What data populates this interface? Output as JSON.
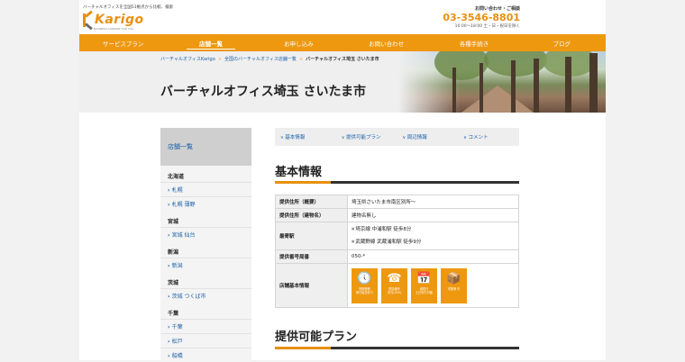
{
  "header": {
    "tagline": "バーチャルオフィスを全国51拠点から比較、検索",
    "logo_text": "Karigo",
    "logo_sub": "BUSINESS SUPPORT FOR YOU",
    "contact_label": "お問い合わせ・ご相談",
    "contact_phone": "03-3546-8801",
    "contact_hours": "10:00〜18:00 土・日・祝日を除く"
  },
  "nav": {
    "items": [
      "サービスプラン",
      "店舗一覧",
      "お申し込み",
      "お問い合わせ",
      "各種手続き",
      "ブログ"
    ]
  },
  "breadcrumb": {
    "items": [
      "バーチャルオフィスKarigo",
      "全国のバーチャルオフィス店舗一覧"
    ],
    "separator": "»",
    "current": "バーチャルオフィス埼玉 さいたま市"
  },
  "page_title": "バーチャルオフィス埼玉 さいたま市",
  "sidebar": {
    "heading": "店舗一覧",
    "groups": [
      {
        "region": "北海道",
        "items": [
          "札幌",
          "札幌 薄野"
        ]
      },
      {
        "region": "宮城",
        "items": [
          "宮城 仙台"
        ]
      },
      {
        "region": "新潟",
        "items": [
          "新潟"
        ]
      },
      {
        "region": "茨城",
        "items": [
          "茨城 つくば市"
        ]
      },
      {
        "region": "千葉",
        "items": [
          "千葉",
          "松戸",
          "船橋"
        ]
      }
    ]
  },
  "tabs": [
    "基本情報",
    "提供可能プラン",
    "周辺情報",
    "コメント"
  ],
  "basic": {
    "title": "基本情報",
    "rows": [
      {
        "label": "提供住所（概要）",
        "value": "埼玉県さいたま市南区別所〜"
      },
      {
        "label": "提供住所（建物名）",
        "value": "建物名無し"
      },
      {
        "label": "最寄駅",
        "values": [
          "埼京線 中浦和駅 徒歩8分",
          "武蔵野線 武蔵浦和駅 徒歩9分"
        ]
      },
      {
        "label": "提供番号局番",
        "value": "050-*"
      },
      {
        "label": "店舗基本情報"
      }
    ],
    "features": [
      {
        "icon": "clock-icon",
        "glyph": "🕔",
        "label": "受取郵便\n即日転送あり"
      },
      {
        "icon": "phone-icon",
        "glyph": "☎",
        "label": "電話番号\n貸与(050)"
      },
      {
        "icon": "calendar-icon",
        "glyph": "📅",
        "label": "最短日\n土日祝も可能"
      },
      {
        "icon": "box-icon",
        "glyph": "📦",
        "label": "宅配便 可"
      }
    ]
  },
  "plans": {
    "title": "提供可能プラン"
  },
  "colors": {
    "accent": "#ee9810",
    "link": "#1a5fa8"
  }
}
